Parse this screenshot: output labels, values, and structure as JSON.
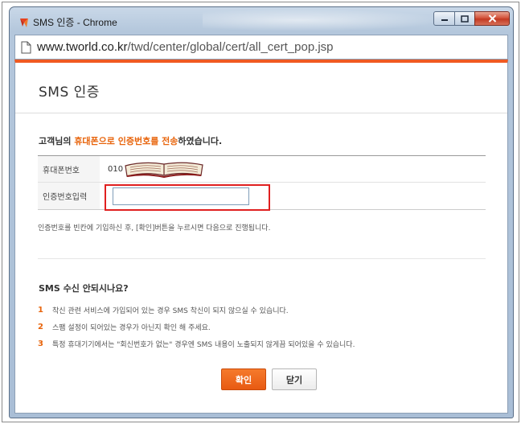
{
  "window": {
    "title": "SMS 인증 - Chrome"
  },
  "address_bar": {
    "domain": "www.tworld.co.kr",
    "path": "/twd/center/global/cert/all_cert_pop.jsp"
  },
  "page": {
    "title": "SMS 인증",
    "notice_prefix": "고객님의 ",
    "notice_highlight": "휴대폰으로 인증번호를 전송",
    "notice_suffix": "하였습니다.",
    "phone_label": "휴대폰번호",
    "phone_value": "010",
    "code_label": "인증번호입력",
    "code_value": "",
    "help_text": "인증번호를 빈칸에 기입하신 후, [확인]버튼을 누르시면 다음으로 진행됩니다.",
    "sms_title": "SMS 수신 안되시나요?",
    "sms_items": [
      {
        "num": "1",
        "text": "착신 관련 서비스에 가입되어 있는 경우 SMS 착신이 되지 않으실 수 있습니다."
      },
      {
        "num": "2",
        "text": "스팸 설정이 되어있는 경우가 아닌지 확인 해 주세요."
      },
      {
        "num": "3",
        "text": "특정 휴대기기에서는 \"회신번호가 없는\" 경우엔 SMS 내용이 노출되지 않게끔 되어있을 수 있습니다."
      }
    ],
    "confirm_label": "확인",
    "close_label": "닫기"
  },
  "colors": {
    "accent": "#f05a22",
    "highlight": "#e8650d",
    "red_box": "#e02020"
  },
  "icons": {
    "title_icon": "tworld-logo-icon",
    "page_icon": "page-icon"
  }
}
